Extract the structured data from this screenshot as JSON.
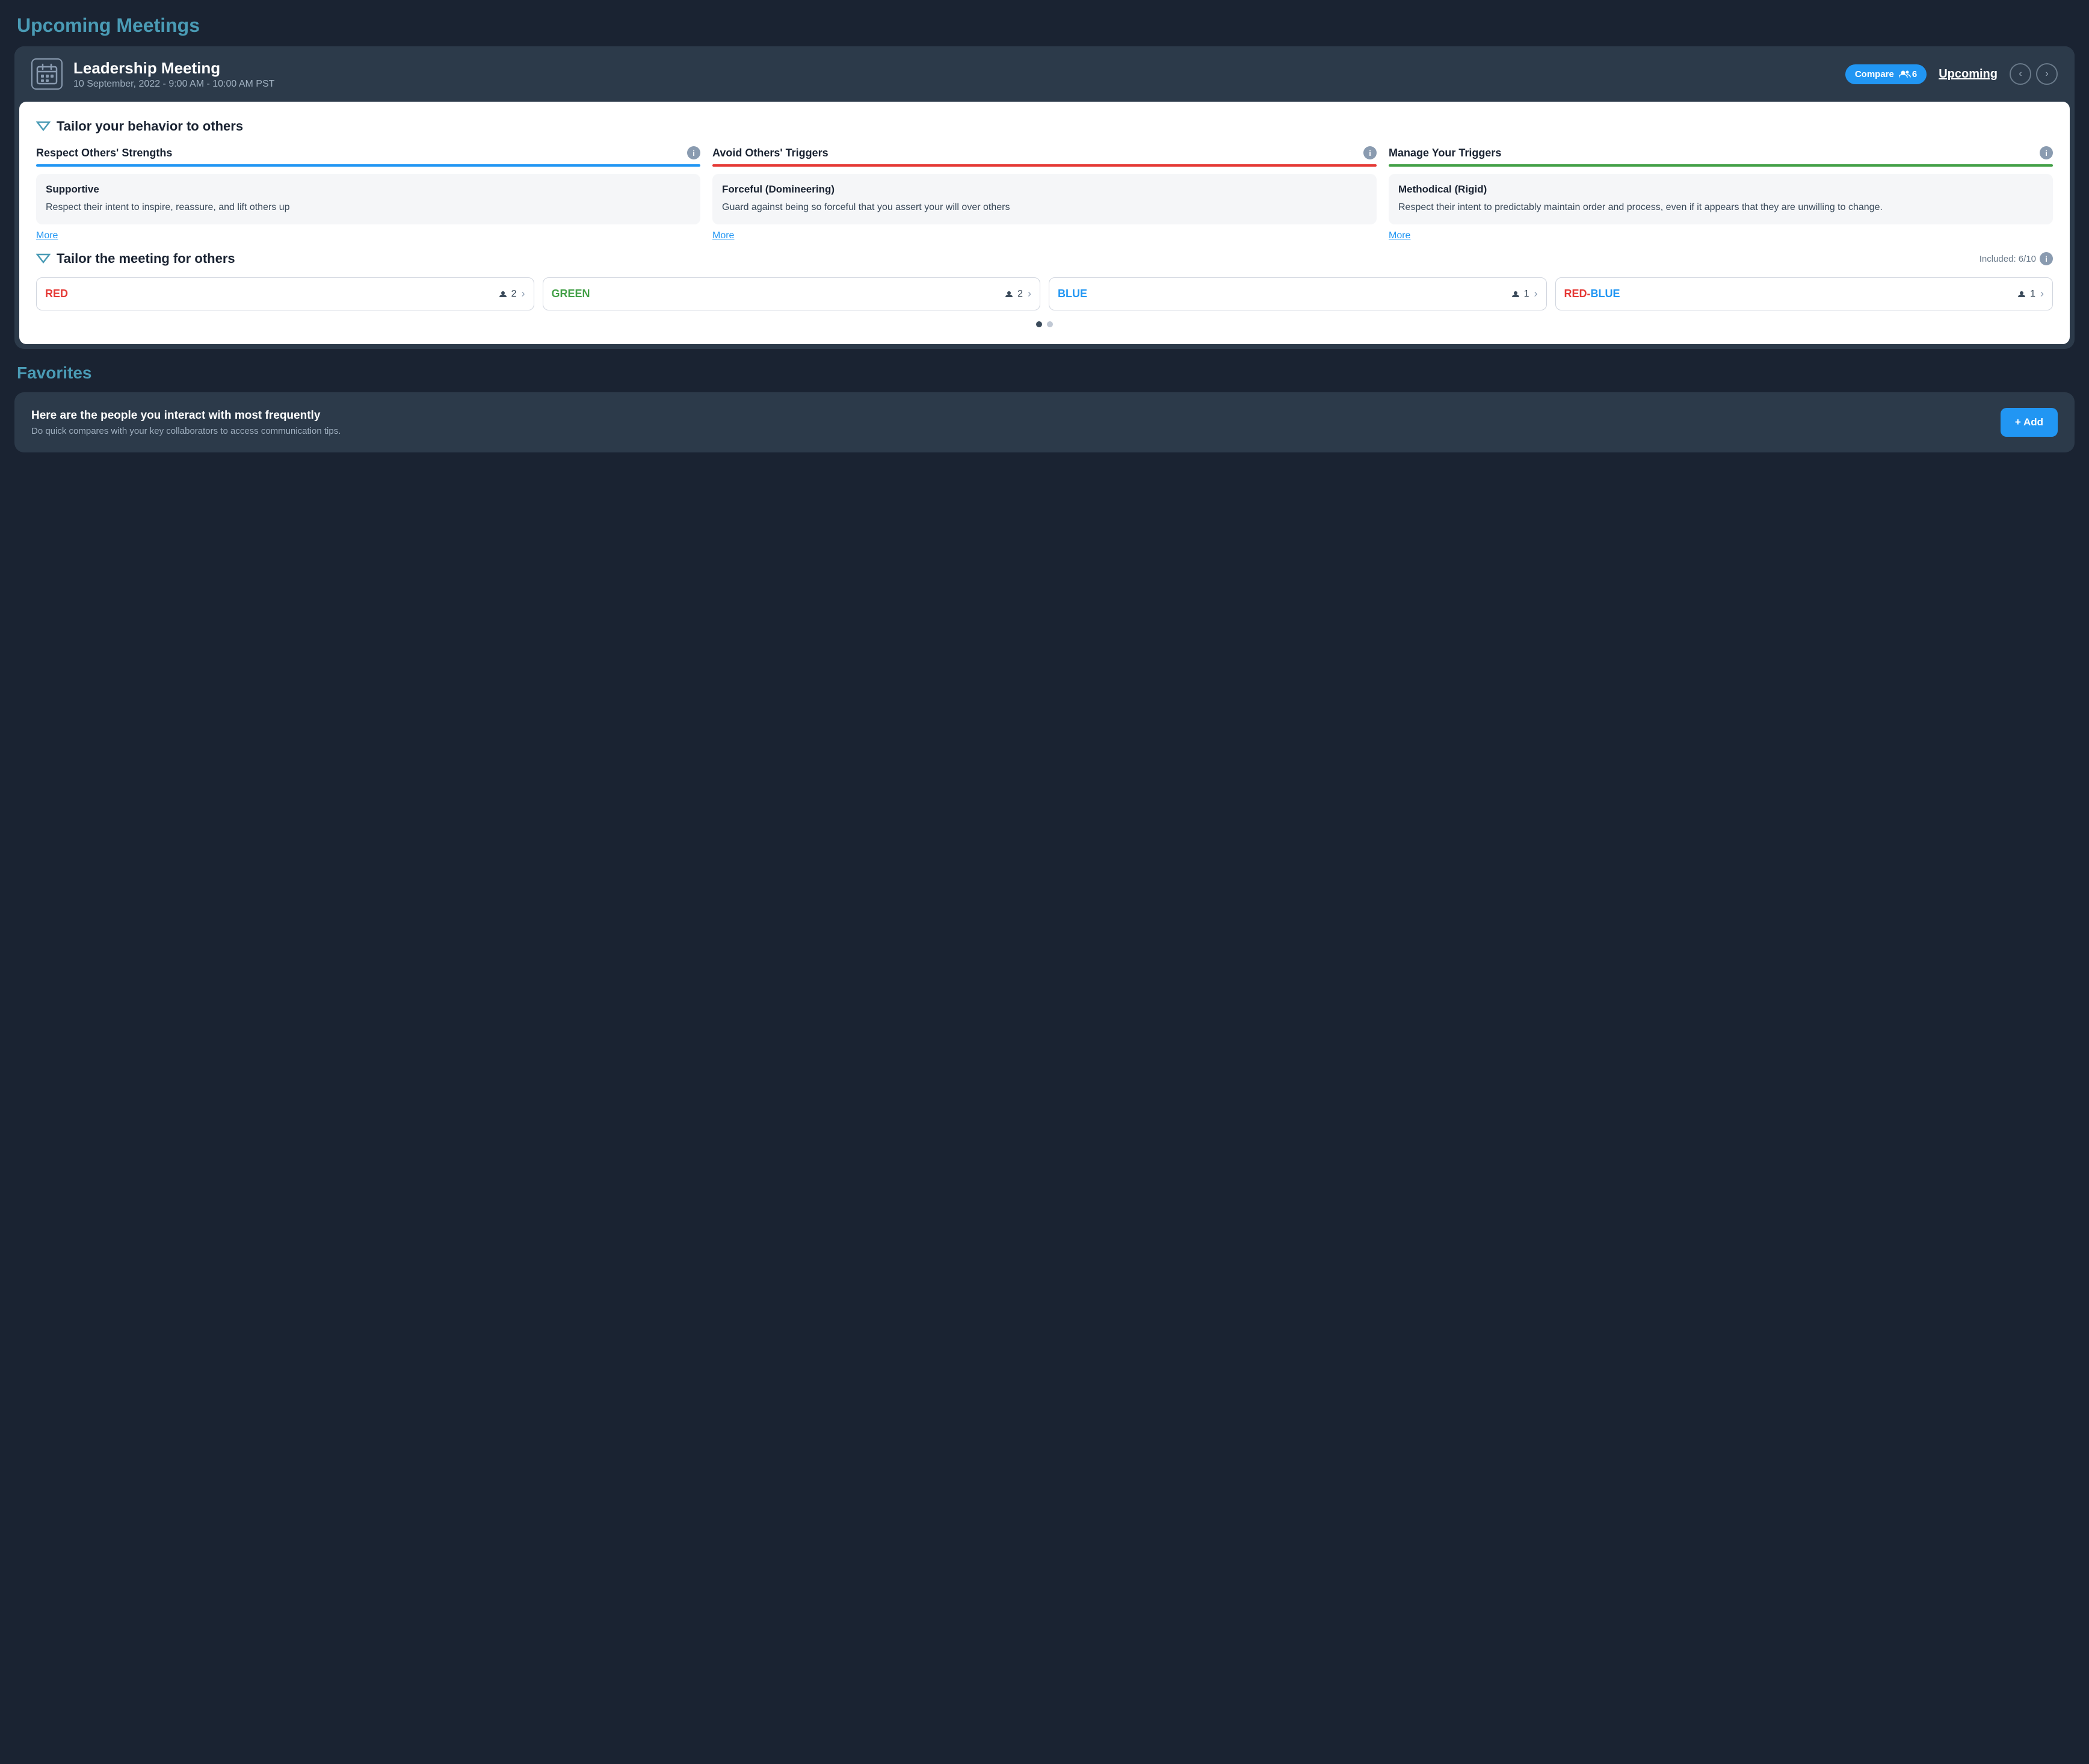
{
  "page": {
    "title": "Upcoming Meetings",
    "favorites_title": "Favorites"
  },
  "meeting": {
    "title": "Leadership Meeting",
    "date": "10 September, 2022 - 9:00 AM - 10:00 AM PST",
    "compare_label": "Compare",
    "compare_count": "6",
    "upcoming_label": "Upcoming"
  },
  "behavior_section": {
    "title": "Tailor your behavior to others",
    "columns": [
      {
        "title": "Respect Others' Strengths",
        "color": "blue",
        "card_title": "Supportive",
        "card_text": "Respect their intent to inspire, reassure, and lift others up",
        "more_label": "More"
      },
      {
        "title": "Avoid Others' Triggers",
        "color": "red",
        "card_title": "Forceful (Domineering)",
        "card_text": "Guard against being so forceful that you assert your will over others",
        "more_label": "More"
      },
      {
        "title": "Manage Your Triggers",
        "color": "green",
        "card_title": "Methodical (Rigid)",
        "card_text": "Respect their intent to predictably maintain order and process, even if it appears that they are unwilling to change.",
        "more_label": "More"
      }
    ]
  },
  "meeting_section": {
    "title": "Tailor the meeting for others",
    "included_label": "Included: 6/10",
    "color_cards": [
      {
        "label": "RED",
        "type": "red",
        "count": "2"
      },
      {
        "label": "GREEN",
        "type": "green",
        "count": "2"
      },
      {
        "label": "BLUE",
        "type": "blue",
        "count": "1"
      },
      {
        "label": "RED-BLUE",
        "type": "red-blue",
        "count": "1"
      }
    ]
  },
  "favorites": {
    "text_title": "Here are the people you interact with most frequently",
    "text_sub": "Do quick compares with your key collaborators to access communication tips.",
    "add_label": "+ Add"
  },
  "icons": {
    "info": "i",
    "prev_arrow": "‹",
    "next_arrow": "›",
    "person_icon": "👤",
    "chevron": "›"
  }
}
